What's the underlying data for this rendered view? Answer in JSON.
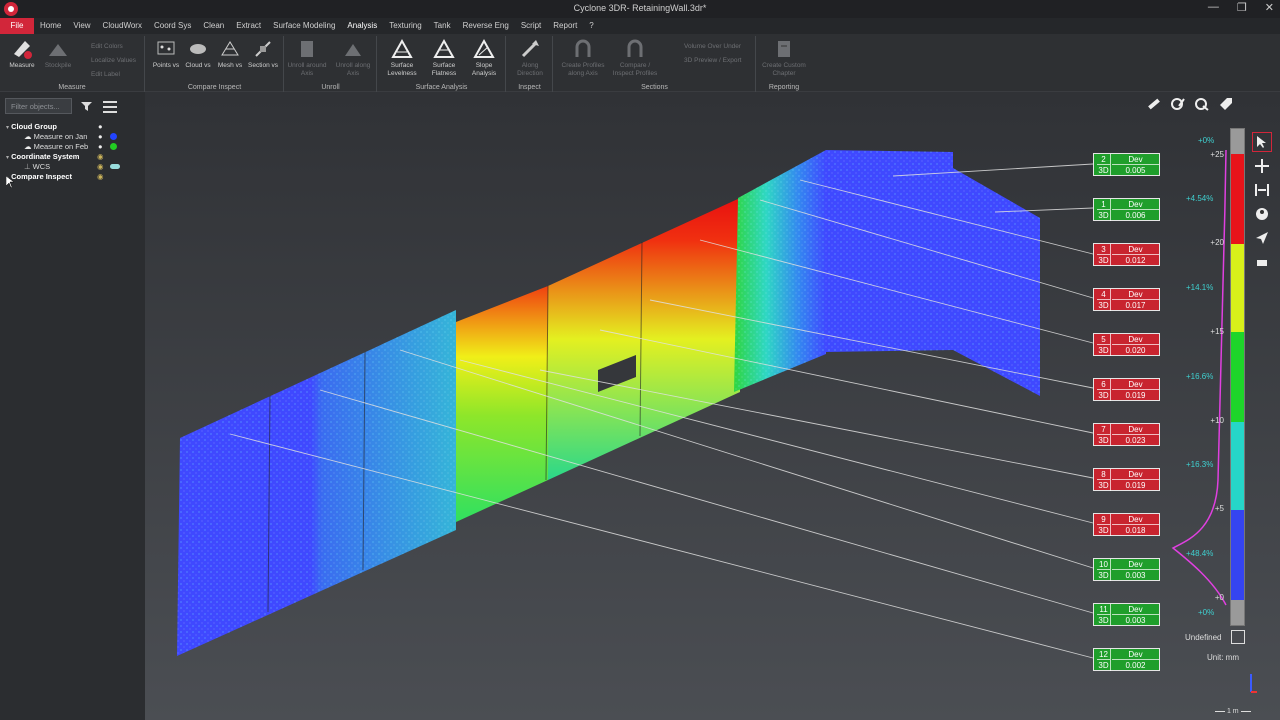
{
  "window": {
    "title": "Cyclone 3DR- RetainingWall.3dr*",
    "controls": [
      "—",
      "❐",
      "✕"
    ]
  },
  "menu": [
    "File",
    "Home",
    "View",
    "CloudWorx",
    "Coord Sys",
    "Clean",
    "Extract",
    "Surface Modeling",
    "Analysis",
    "Texturing",
    "Tank",
    "Reverse Eng",
    "Script",
    "Report",
    "?"
  ],
  "ribbon": {
    "measure": {
      "button": "Measure",
      "extra": [
        "Stockpile"
      ],
      "small": [
        "Edit Colors",
        "Localize Values",
        "Edit Label"
      ],
      "group": "Measure"
    },
    "compare": {
      "buttons": [
        "Points vs",
        "Cloud vs",
        "Mesh vs",
        "Section vs"
      ],
      "group": "Compare Inspect"
    },
    "unroll": {
      "buttons": [
        "Unroll around Axis",
        "Unroll along Axis"
      ],
      "group": "Unroll"
    },
    "surface": {
      "buttons": [
        "Surface Levelness",
        "Surface Flatness",
        "Slope Analysis"
      ],
      "group": "Surface Analysis"
    },
    "inspect": {
      "buttons": [
        "Along Direction"
      ],
      "group": "Inspect"
    },
    "sections": {
      "buttons": [
        "Create Profiles along Axis",
        "Compare / Inspect Profiles"
      ],
      "small": [
        "Volume Over Under",
        "3D Preview / Export"
      ],
      "group": "Sections"
    },
    "reporting": {
      "buttons": [
        "Create Custom Chapter"
      ],
      "group": "Reporting"
    }
  },
  "sidebar": {
    "filter_placeholder": "Filter objects...",
    "tree": [
      {
        "label": "Cloud Group",
        "bold": true
      },
      {
        "label": "Measure on Jan",
        "color": "#2244ff"
      },
      {
        "label": "Measure on Feb",
        "color": "#22cc22"
      },
      {
        "label": "Coordinate System",
        "bold": true
      },
      {
        "label": "WCS"
      },
      {
        "label": "Compare Inspect",
        "bold": true
      }
    ]
  },
  "labels": [
    {
      "id": "2",
      "dev": "0.005",
      "kind": "Dev",
      "mode": "3D",
      "status": "g"
    },
    {
      "id": "1",
      "dev": "0.006",
      "kind": "Dev",
      "mode": "3D",
      "status": "g"
    },
    {
      "id": "3",
      "dev": "0.012",
      "kind": "Dev",
      "mode": "3D",
      "status": "r"
    },
    {
      "id": "4",
      "dev": "0.017",
      "kind": "Dev",
      "mode": "3D",
      "status": "r"
    },
    {
      "id": "5",
      "dev": "0.020",
      "kind": "Dev",
      "mode": "3D",
      "status": "r"
    },
    {
      "id": "6",
      "dev": "0.019",
      "kind": "Dev",
      "mode": "3D",
      "status": "r"
    },
    {
      "id": "7",
      "dev": "0.023",
      "kind": "Dev",
      "mode": "3D",
      "status": "r"
    },
    {
      "id": "8",
      "dev": "0.019",
      "kind": "Dev",
      "mode": "3D",
      "status": "r"
    },
    {
      "id": "9",
      "dev": "0.018",
      "kind": "Dev",
      "mode": "3D",
      "status": "r"
    },
    {
      "id": "10",
      "dev": "0.003",
      "kind": "Dev",
      "mode": "3D",
      "status": "g"
    },
    {
      "id": "11",
      "dev": "0.003",
      "kind": "Dev",
      "mode": "3D",
      "status": "g"
    },
    {
      "id": "12",
      "dev": "0.002",
      "kind": "Dev",
      "mode": "3D",
      "status": "g"
    }
  ],
  "colorbar": {
    "ticks": [
      "+25",
      "+20",
      "+15",
      "+10",
      "+5",
      "+0"
    ],
    "percents": [
      "+0%",
      "+4.54%",
      "+14.1%",
      "+16.6%",
      "+16.3%",
      "+48.4%",
      "+0%"
    ],
    "undefined_label": "Undefined",
    "unit": "Unit: mm",
    "scale": "1 m"
  },
  "colors": {
    "accent": "#d2263a",
    "ok": "#1f9e2b",
    "bad": "#c8242f"
  }
}
